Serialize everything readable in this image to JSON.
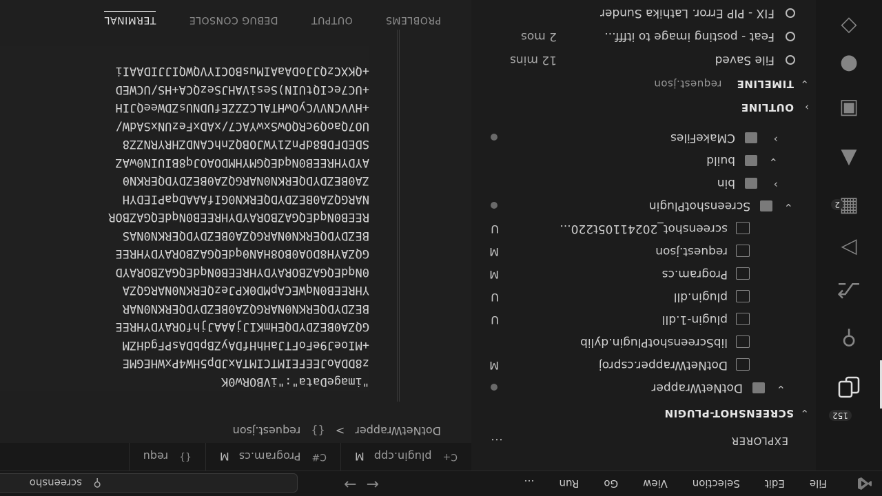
{
  "menu": [
    "File",
    "Edit",
    "Selection",
    "View",
    "Go",
    "Run",
    "…"
  ],
  "command_center": {
    "text": "screensho"
  },
  "activity": {
    "source_control_badge": "2",
    "explorer_badge": "152"
  },
  "sidebar": {
    "title": "EXPLORER",
    "more": "…",
    "root": "SCREENSHOT-PLUGIN",
    "tree": [
      {
        "name": "DotNetWrapper",
        "indent": 1,
        "chev": "v",
        "icon": "folder",
        "status": "dot"
      },
      {
        "name": "DotNetWrapper.csproj",
        "indent": 2,
        "chev": "",
        "icon": "csproj",
        "status": "M"
      },
      {
        "name": "libScreenshotPlugin.dylib",
        "indent": 2,
        "chev": "",
        "icon": "file",
        "status": ""
      },
      {
        "name": "plugin-1.dll",
        "indent": 2,
        "chev": "",
        "icon": "dll",
        "status": "U"
      },
      {
        "name": "plugin.dll",
        "indent": 2,
        "chev": "",
        "icon": "dll",
        "status": "U"
      },
      {
        "name": "Program.cs",
        "indent": 2,
        "chev": "",
        "icon": "cs",
        "status": "M"
      },
      {
        "name": "request.json",
        "indent": 2,
        "chev": "",
        "icon": "json",
        "status": "M"
      },
      {
        "name": "screenshot_20241105t220...",
        "indent": 2,
        "chev": "",
        "icon": "image",
        "status": "U"
      },
      {
        "name": "ScreenshotPlugin",
        "indent": 0.5,
        "chev": "v",
        "icon": "folder",
        "status": "dot"
      },
      {
        "name": "bin",
        "indent": 1.5,
        "chev": ">",
        "icon": "folder",
        "status": ""
      },
      {
        "name": "build",
        "indent": 1.5,
        "chev": "v",
        "icon": "folder",
        "status": ""
      },
      {
        "name": "CMakeFiles",
        "indent": 1.5,
        "chev": ">",
        "icon": "folder",
        "status": "dot"
      }
    ],
    "outline": "OUTLINE",
    "timeline": {
      "label": "TIMELINE",
      "file": "request.json"
    },
    "timeline_items": [
      {
        "label": "File Saved",
        "age": "12 mins"
      },
      {
        "label": "Feat - posting image to itfff...",
        "age": "2 mos"
      },
      {
        "label": "FIX - PIP Error. Lathika Sunder",
        "age": ""
      }
    ]
  },
  "tabs": [
    {
      "label": "plugin.cpp",
      "icon": "C+",
      "mod": "M"
    },
    {
      "label": "Program.cs",
      "icon": "C#",
      "mod": "M"
    },
    {
      "label": "requ",
      "icon": "{}",
      "mod": ""
    }
  ],
  "breadcrumb": {
    "folder": "DotNetWrapper",
    "sep": ">",
    "file": "request.json"
  },
  "code_lines": [
    "\"imageData\":\"iVBORw0K",
    "z8DDAoJEEFEIMTCIMTAxJDp5HW4PxWHEGME",
    "+MIoeJ9eFoFTJaHhHfDAyZBpbDAsPFgdHZM",
    "GQZA0BEZDYDQEHmKIJjAAAJjhfORAYDYHREE",
    "BEZDYDQERKN0NARGQZA0BEZDYDQERKN0NAR",
    "YHREEB0NqWECApMD0KPJezQERKN0NARGQZA",
    "0NqdEQGAZBORAYDYHREEB0NqdEQGAZBORAYD",
    "GQZAYH8DOA0BO8HAN0qdEQGAZBORAYDYHREE",
    "BEZDYDQERKN0NARGQZA0BEZDYDQERKN0NAS",
    "REEB0NqdEQGAZBORAYDYHREEB0NqdEQGAZBOR",
    "NARGQZA0BEZDYDQERKN0GIfAAADqaPIEDYH",
    "ZA0BEZDYDQERKN0NARGQZA0BEZDYDQERKN0",
    "AYDYHREEB0NqdEQGMYHMDOAOJq8BIUIN0wAZ",
    "SDEDFDB8dPnZ1YWJOBQZnhCANDZHRYRNZZ8",
    "UO7QaoQ9cRQOwSxwYAC7/xADxFezUNxSAdW/",
    "+HVVCNVVCyOwHTALCZZZEfUDNUsZDWeeQJIH",
    "+UC7ecIQtUIN)SesiVAHJSezQCA+HS/UCWED",
    "+QKXCzQJJoDAaAIMusBOCIYVQWQIJJIDAAIi"
  ],
  "panel_tabs": [
    "PROBLEMS",
    "OUTPUT",
    "DEBUG CONSOLE",
    "TERMINAL"
  ],
  "panel_active": "TERMINAL"
}
